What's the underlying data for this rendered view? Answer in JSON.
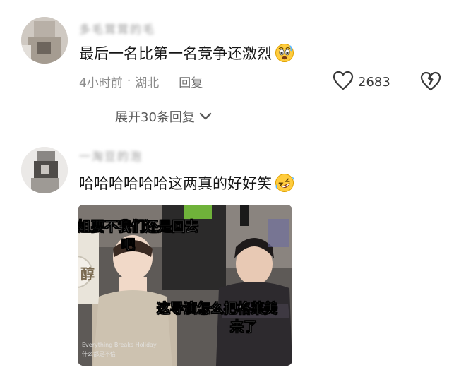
{
  "comments": [
    {
      "username": "多毛茸茸的毛",
      "text": "最后一名比第一名竞争还激烈",
      "emoji": "worried-face-emoji",
      "time": "4小时前",
      "location": "湖北",
      "reply_label": "回复",
      "likes": "2683",
      "expand_label": "展开30条回复"
    },
    {
      "username": "一淘豆的泡",
      "text": "哈哈哈哈哈哈这两真的好好笑",
      "emoji": "rolling-laughing-emoji"
    }
  ],
  "meme": {
    "caption_top_line1": "姐要不我们还是回去",
    "caption_top_line2": "吧",
    "caption_bottom_line1": "这导演怎么把格莱美",
    "caption_bottom_line2": "来了",
    "sign_char": "醇",
    "watermark_line1": "Everything Breaks Holiday",
    "watermark_line2": "什么都是不信"
  },
  "colors": {
    "text_primary": "#161616",
    "text_secondary": "#8c8c8c",
    "background": "#ffffff"
  }
}
